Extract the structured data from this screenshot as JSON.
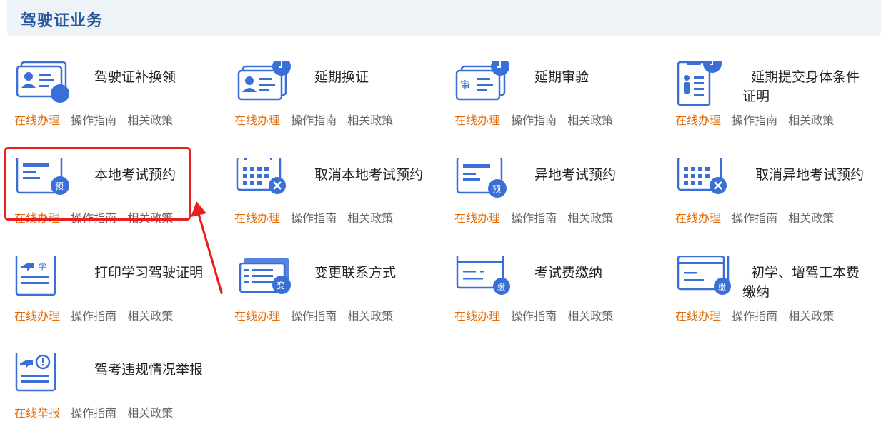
{
  "header": {
    "title": "驾驶证业务"
  },
  "colors": {
    "accent": "#3a6fd8",
    "online_link": "#e36c0a",
    "highlight": "#e8201e"
  },
  "items": [
    {
      "title": "驾驶证补换领",
      "icon": "license-replace-icon",
      "links": [
        "在线办理",
        "操作指南",
        "相关政策"
      ]
    },
    {
      "title": "延期换证",
      "icon": "license-extend-clock-icon",
      "links": [
        "在线办理",
        "操作指南",
        "相关政策"
      ]
    },
    {
      "title": "延期审验",
      "icon": "review-extend-clock-icon",
      "links": [
        "在线办理",
        "操作指南",
        "相关政策"
      ]
    },
    {
      "title": "延期提交身体条件证明",
      "icon": "health-certificate-clock-icon",
      "links": [
        "在线办理",
        "操作指南",
        "相关政策"
      ]
    },
    {
      "title": "本地考试预约",
      "icon": "local-exam-booking-icon",
      "links": [
        "在线办理",
        "操作指南",
        "相关政策"
      ]
    },
    {
      "title": "取消本地考试预约",
      "icon": "cancel-local-exam-calendar-icon",
      "links": [
        "在线办理",
        "操作指南",
        "相关政策"
      ]
    },
    {
      "title": "异地考试预约",
      "icon": "remote-exam-booking-icon",
      "links": [
        "在线办理",
        "操作指南",
        "相关政策"
      ]
    },
    {
      "title": "取消异地考试预约",
      "icon": "cancel-remote-exam-calendar-icon",
      "links": [
        "在线办理",
        "操作指南",
        "相关政策"
      ]
    },
    {
      "title": "打印学习驾驶证明",
      "icon": "learner-permit-print-icon",
      "links": [
        "在线办理",
        "操作指南",
        "相关政策"
      ]
    },
    {
      "title": "变更联系方式",
      "icon": "change-contact-icon",
      "links": [
        "在线办理",
        "操作指南",
        "相关政策"
      ]
    },
    {
      "title": "考试费缴纳",
      "icon": "exam-fee-payment-icon",
      "links": [
        "在线办理",
        "操作指南",
        "相关政策"
      ]
    },
    {
      "title": "初学、增驾工本费缴纳",
      "icon": "permit-fee-payment-icon",
      "links": [
        "在线办理",
        "操作指南",
        "相关政策"
      ]
    },
    {
      "title": "驾考违规情况举报",
      "icon": "violation-report-icon",
      "links": [
        "在线举报",
        "操作指南",
        "相关政策"
      ]
    }
  ],
  "badges": {
    "yu": "预",
    "bian": "变",
    "jiao": "缴",
    "xue": "学",
    "shen": "审"
  }
}
